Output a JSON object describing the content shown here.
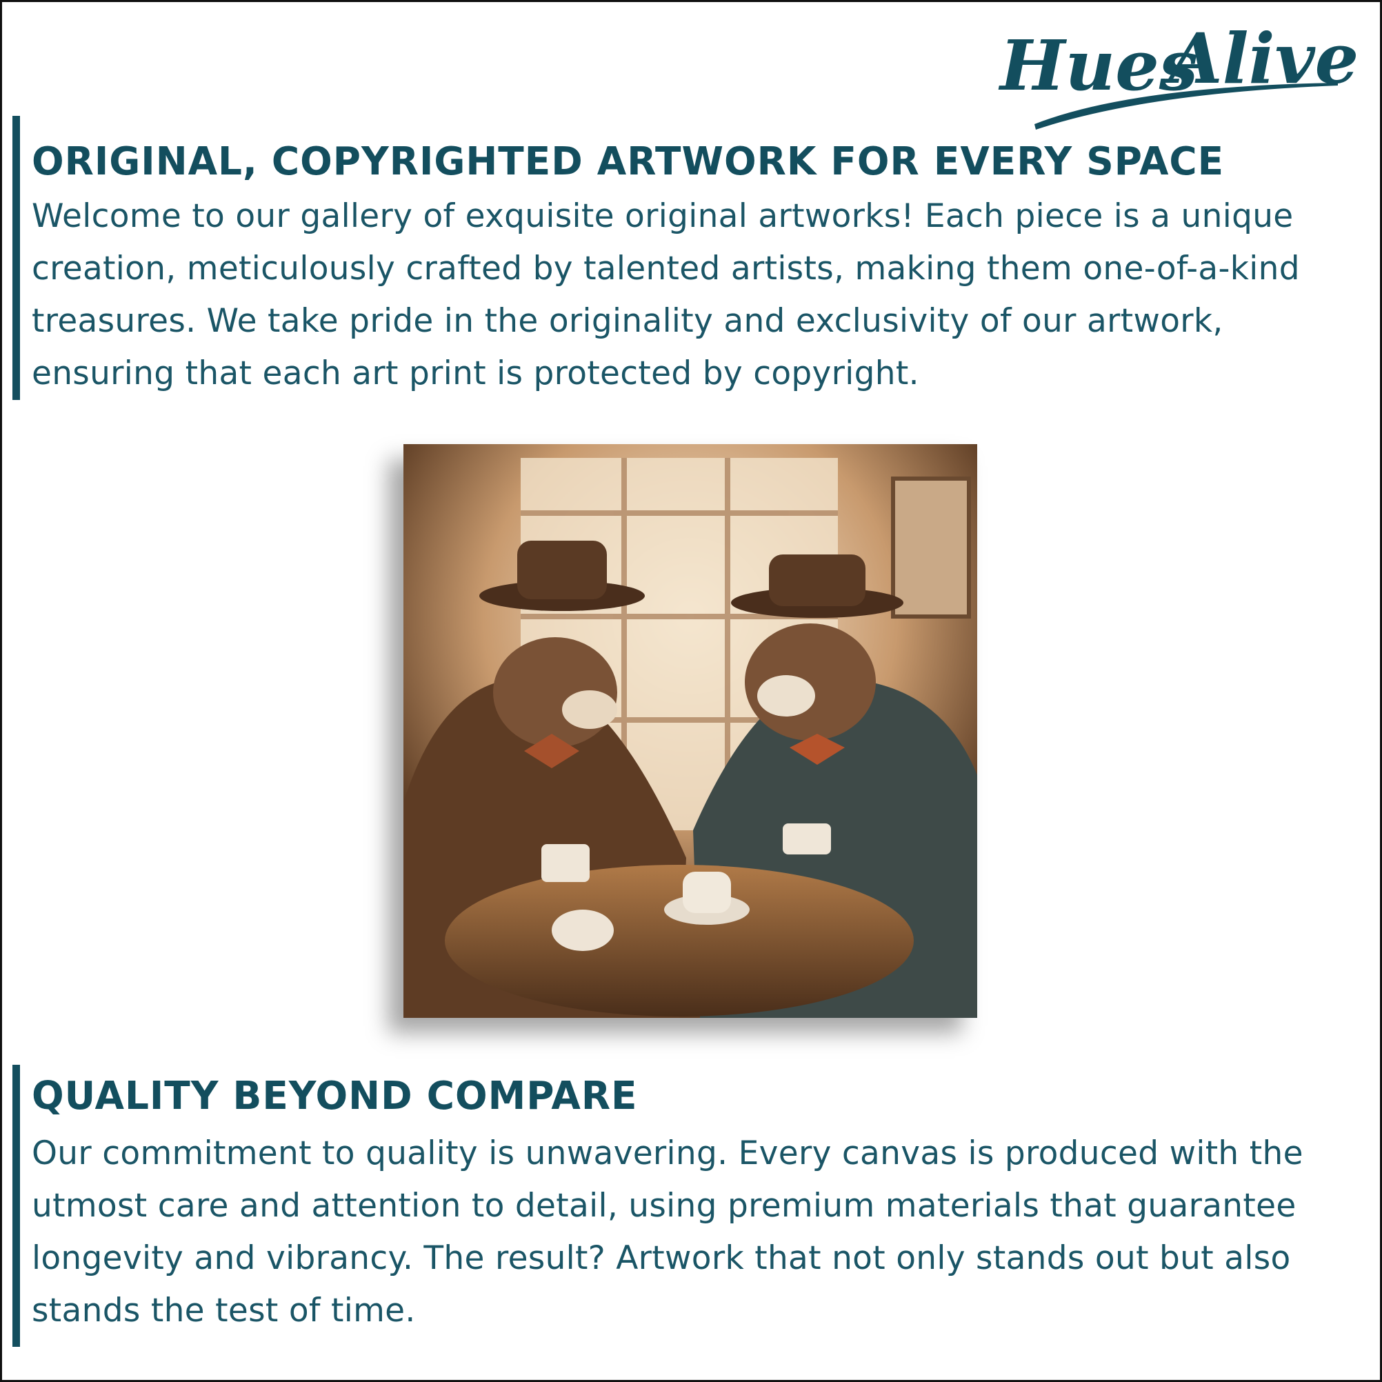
{
  "brand": {
    "logo_text": "Hues Alive",
    "color": "#134e5e"
  },
  "section1": {
    "heading": "ORIGINAL, COPYRIGHTED ARTWORK FOR EVERY SPACE",
    "body": "Welcome to our gallery of exquisite original artworks! Each piece is a unique creation, meticulously crafted by talented artists, making them one-of-a-kind treasures. We take pride in the originality and exclusivity of our artwork, ensuring that each art print is protected by copyright."
  },
  "artwork": {
    "subject": "two-bears-in-top-hats-drinking-coffee-painting"
  },
  "section2": {
    "heading": "QUALITY BEYOND COMPARE",
    "body": "Our commitment to quality is unwavering. Every canvas is produced with the utmost care and attention to detail, using premium materials that guarantee longevity and vibrancy. The result? Artwork that not only stands out but also stands the test of time."
  }
}
